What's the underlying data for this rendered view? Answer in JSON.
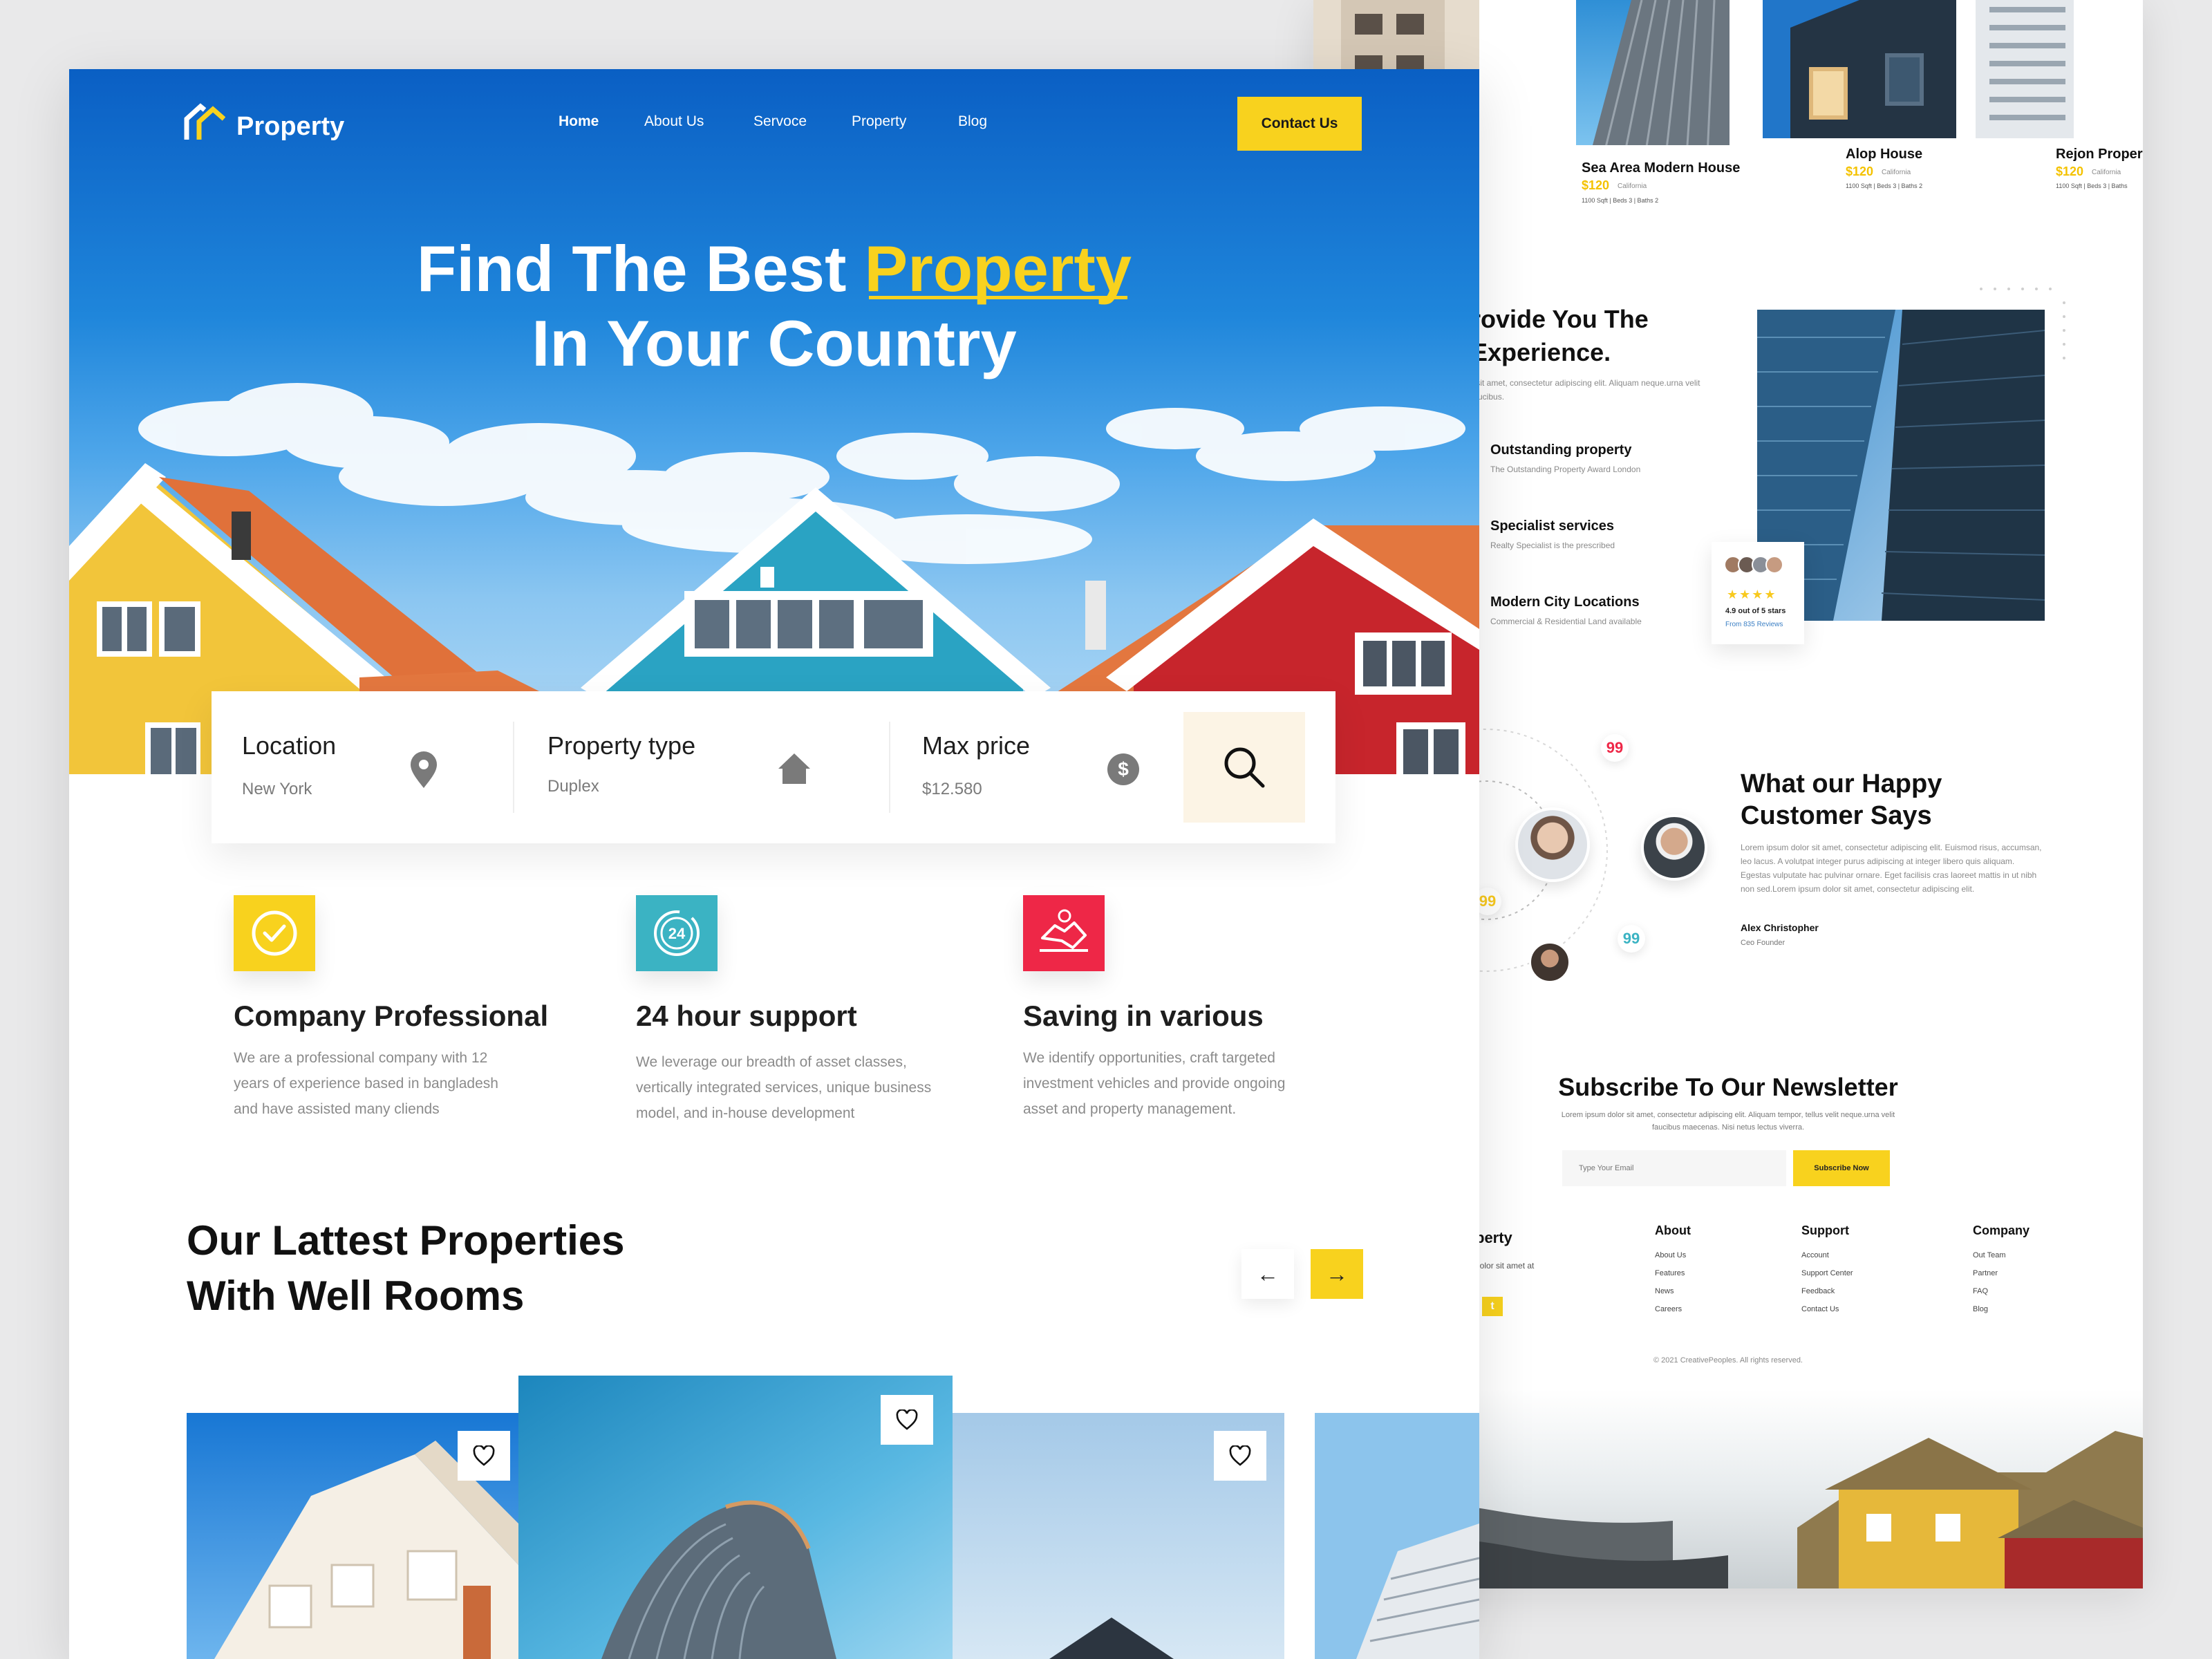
{
  "back_page": {
    "cards": [
      {
        "title": "",
        "price": "",
        "location": "",
        "meta": ""
      },
      {
        "title": "Sea Area Modern House",
        "price": "$120",
        "location": "California",
        "meta": "1100 Sqft  |  Beds 3  |  Baths 2"
      },
      {
        "title": "Alop House",
        "price": "$120",
        "location": "California",
        "meta": "1100 Sqft  |  Beds 3  |  Baths 2"
      },
      {
        "title": "Rejon Property",
        "price": "$120",
        "location": "California",
        "meta": "1100 Sqft  |  Beds 3  |  Baths"
      }
    ],
    "experience": {
      "title_line1": "rovide You The",
      "title_line2": "Experience.",
      "desc": "r sit amet, consectetur adipiscing elit. Aliquam neque.urna velit faucibus.",
      "features": [
        {
          "title": "Outstanding property",
          "sub": "The Outstanding Property Award London"
        },
        {
          "title": "Specialist services",
          "sub": "Realty Specialist is the prescribed"
        },
        {
          "title": "Modern City Locations",
          "sub": "Commercial & Residential Land available"
        }
      ],
      "rating": {
        "stars": "★★★★",
        "text": "4.9 out of 5 stars",
        "reviews": "From 835 Reviews"
      }
    },
    "testimonial": {
      "title_line1": "What our Happy",
      "title_line2": "Customer Says",
      "body": "Lorem ipsum dolor sit amet, consectetur adipiscing elit. Euismod risus, accumsan, leo lacus. A volutpat integer purus adipiscing at integer libero quis aliquam. Egestas vulputate hac pulvinar ornare. Eget facilisis cras laoreet mattis in ut nibh non sed.Lorem ipsum dolor sit amet, consectetur adipiscing elit.",
      "author": "Alex Christopher",
      "role": "Ceo Founder"
    },
    "newsletter": {
      "title": "Subscribe To Our Newsletter",
      "desc": "Lorem ipsum dolor sit amet, consectetur adipiscing elit. Aliquam tempor, tellus velit neque.urna velit faucibus maecenas. Nisi netus lectus viverra.",
      "placeholder": "Type Your Email",
      "button": "Subscribe Now"
    },
    "footer": {
      "brand": "perty",
      "brand_desc": "dolor sit amet at",
      "columns": [
        {
          "title": "About",
          "links": [
            "About Us",
            "Features",
            "News",
            "Careers"
          ]
        },
        {
          "title": "Support",
          "links": [
            "Account",
            "Support Center",
            "Feedback",
            "Contact Us"
          ]
        },
        {
          "title": "Company",
          "links": [
            "Out Team",
            "Partner",
            "FAQ",
            "Blog"
          ]
        }
      ],
      "copyright": "© 2021 CreativePeoples. All rights reserved."
    }
  },
  "front_page": {
    "logo": "Property",
    "nav": [
      "Home",
      "About Us",
      "Servoce",
      "Property",
      "Blog"
    ],
    "contact_button": "Contact Us",
    "hero": {
      "line1_pre": "Find The Best ",
      "line1_highlight": "Property",
      "line2": "In Your Country"
    },
    "search": {
      "fields": [
        {
          "label": "Location",
          "value": "New York",
          "icon": "location-pin-icon"
        },
        {
          "label": "Property type",
          "value": "Duplex",
          "icon": "home-icon"
        },
        {
          "label": "Max price",
          "value": "$12.580",
          "icon": "dollar-icon"
        }
      ],
      "button_icon": "search-icon"
    },
    "features": [
      {
        "title": "Company Professional",
        "desc": "We are a professional company with 12 years of experience based in bangladesh and have assisted many cliends",
        "icon": "check-circle-icon",
        "color": "#f8d21e"
      },
      {
        "title": "24 hour support",
        "desc": "We leverage our breadth of asset classes, vertically integrated services, unique business model, and in-house development",
        "icon": "clock-24-icon",
        "color": "#3bb3c3"
      },
      {
        "title": "Saving in various",
        "desc": "We identify opportunities, craft targeted investment vehicles and provide ongoing asset and property management.",
        "icon": "handshake-icon",
        "color": "#ee2747"
      }
    ],
    "latest": {
      "title_line1": "Our Lattest Properties",
      "title_line2": "With Well Rooms",
      "prev": "←",
      "next": "→"
    }
  },
  "colors": {
    "accent": "#f8d21e",
    "primary_blue": "#0a62c6",
    "teal": "#3bb3c3",
    "red": "#ee2747"
  }
}
